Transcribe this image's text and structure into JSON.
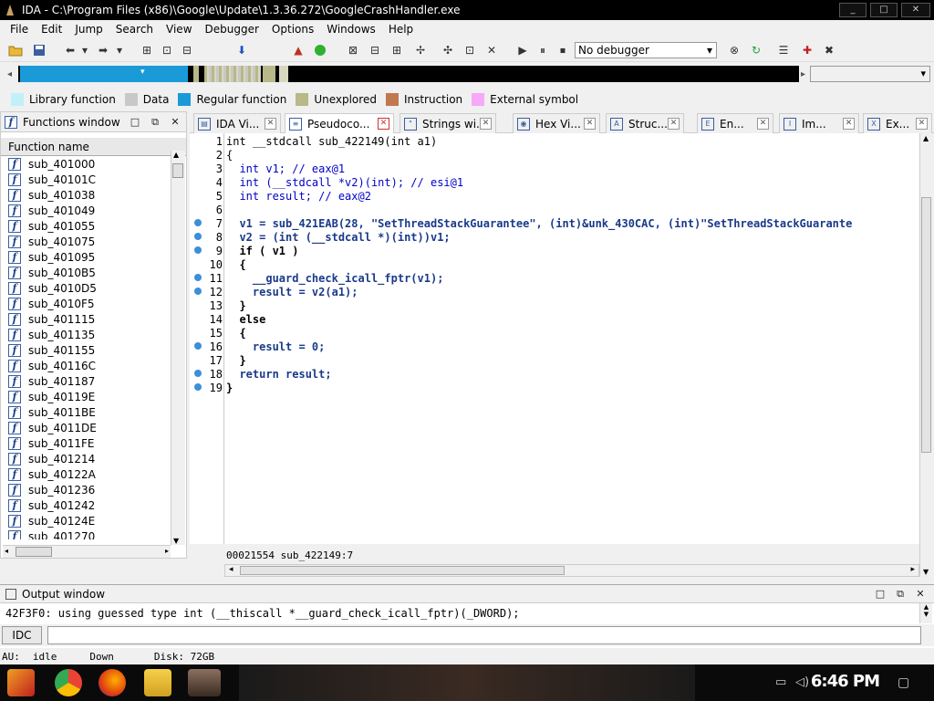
{
  "window": {
    "title": "IDA - C:\\Program Files (x86)\\Google\\Update\\1.3.36.272\\GoogleCrashHandler.exe",
    "min": "_",
    "max": "□",
    "close": "✕"
  },
  "menu": [
    "File",
    "Edit",
    "Jump",
    "Search",
    "View",
    "Debugger",
    "Options",
    "Windows",
    "Help"
  ],
  "toolbar": {
    "debugger_select": "No debugger"
  },
  "legend": [
    {
      "label": "Library function",
      "color": "#c0f0f8"
    },
    {
      "label": "Data",
      "color": "#c8c8c8"
    },
    {
      "label": "Regular function",
      "color": "#1a9bd8"
    },
    {
      "label": "Unexplored",
      "color": "#b8b888"
    },
    {
      "label": "Instruction",
      "color": "#c07850"
    },
    {
      "label": "External symbol",
      "color": "#f8a8f8"
    }
  ],
  "functions_window": {
    "title": "Functions window",
    "column": "Function name",
    "items": [
      "sub_401000",
      "sub_40101C",
      "sub_401038",
      "sub_401049",
      "sub_401055",
      "sub_401075",
      "sub_401095",
      "sub_4010B5",
      "sub_4010D5",
      "sub_4010F5",
      "sub_401115",
      "sub_401135",
      "sub_401155",
      "sub_40116C",
      "sub_401187",
      "sub_40119E",
      "sub_4011BE",
      "sub_4011DE",
      "sub_4011FE",
      "sub_401214",
      "sub_40122A",
      "sub_401236",
      "sub_401242",
      "sub_40124E",
      "sub_401270"
    ]
  },
  "tabs": [
    {
      "label": "IDA Vi...",
      "icon": "ida-view-icon"
    },
    {
      "label": "Pseudoco...",
      "icon": "pseudocode-icon"
    },
    {
      "label": "Strings wi...",
      "icon": "strings-icon"
    },
    {
      "label": "Hex Vi...",
      "icon": "hex-icon"
    },
    {
      "label": "Struc...",
      "icon": "struct-icon"
    },
    {
      "label": "En...",
      "icon": "enum-icon"
    },
    {
      "label": "Im...",
      "icon": "imports-icon"
    },
    {
      "label": "Ex...",
      "icon": "exports-icon"
    }
  ],
  "code": {
    "line_numbers": [
      "1",
      "2",
      "3",
      "4",
      "5",
      "6",
      "7",
      "8",
      "9",
      "10",
      "11",
      "12",
      "13",
      "14",
      "15",
      "16",
      "17",
      "18",
      "19"
    ],
    "lines": [
      "int __stdcall sub_422149(int a1)",
      "{",
      "  int v1; // eax@1",
      "  int (__stdcall *v2)(int); // esi@1",
      "  int result; // eax@2",
      "",
      "  v1 = sub_421EAB(28, \"SetThreadStackGuarantee\", (int)&unk_430CAC, (int)\"SetThreadStackGuarante",
      "  v2 = (int (__stdcall *)(int))v1;",
      "  if ( v1 )",
      "  {",
      "    __guard_check_icall_fptr(v1);",
      "    result = v2(a1);",
      "  }",
      "  else",
      "  {",
      "    result = 0;",
      "  }",
      "  return result;",
      "}"
    ],
    "status": "00021554 sub_422149:7"
  },
  "output_window": {
    "title": "Output window",
    "text": "42F3F0: using guessed type int (__thiscall *__guard_check_icall_fptr)(_DWORD);",
    "idc_label": "IDC"
  },
  "statusbar": {
    "au": "AU:",
    "state": "idle",
    "direction": "Down",
    "disk": "Disk: 72GB"
  },
  "taskbar": {
    "time": "6:46 PM"
  }
}
